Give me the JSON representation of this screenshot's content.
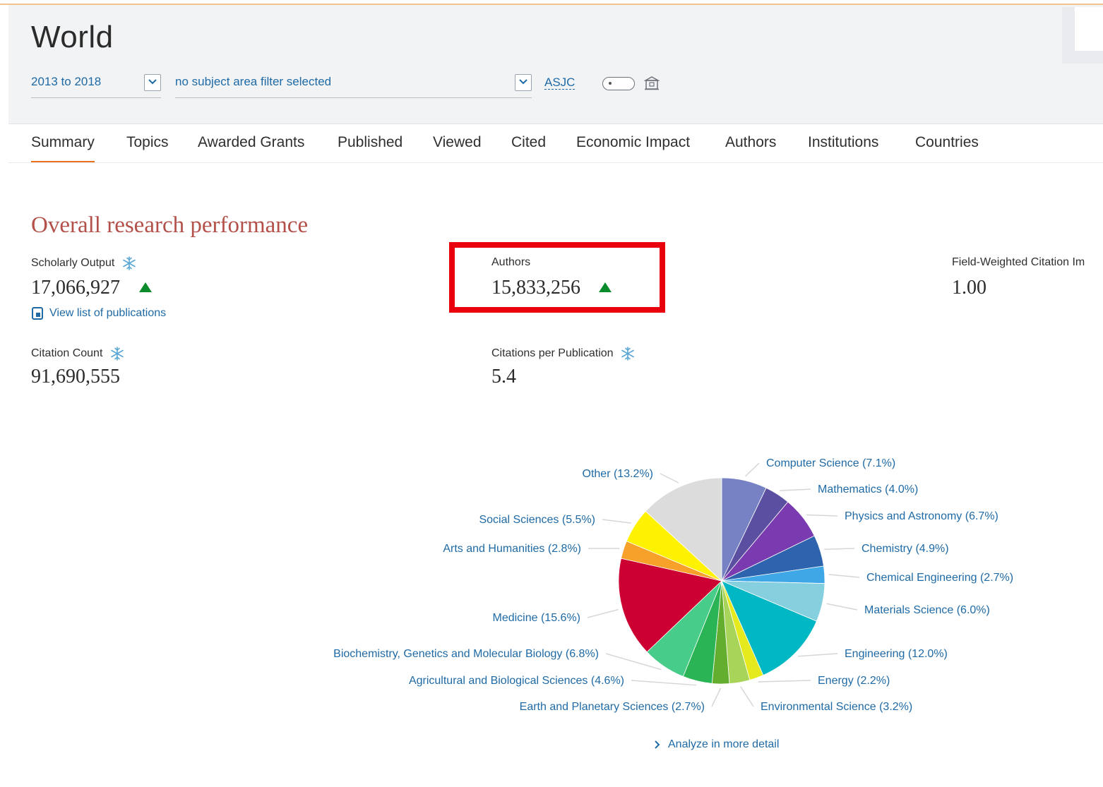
{
  "header": {
    "title": "World",
    "year_range": "2013 to 2018",
    "subject_filter": "no subject area filter selected",
    "asjc_label": "ASJC"
  },
  "tabs": [
    {
      "label": "Summary",
      "active": true
    },
    {
      "label": "Topics"
    },
    {
      "label": "Awarded Grants"
    },
    {
      "label": "Published"
    },
    {
      "label": "Viewed"
    },
    {
      "label": "Cited"
    },
    {
      "label": "Economic Impact"
    },
    {
      "label": "Authors"
    },
    {
      "label": "Institutions"
    },
    {
      "label": "Countries"
    }
  ],
  "overview": {
    "title": "Overall research performance",
    "scholarly_output_label": "Scholarly Output",
    "scholarly_output_value": "17,066,927",
    "view_list_label": "View list of publications",
    "authors_label": "Authors",
    "authors_value": "15,833,256",
    "fwci_label": "Field-Weighted Citation Im",
    "fwci_value": "1.00",
    "citation_count_label": "Citation Count",
    "citation_count_value": "91,690,555",
    "cpp_label": "Citations per Publication",
    "cpp_value": "5.4"
  },
  "analyze_label": "Analyze in more detail",
  "colors": {
    "accent_orange": "#e9711c",
    "section_title": "#b3504a",
    "link_blue": "#1f6aa5",
    "trend_up_green": "#0b8b2b",
    "highlight_red": "#e8000d"
  },
  "chart_data": {
    "type": "pie",
    "series": [
      {
        "label": "Computer Science (7.1%)",
        "value": 7.1,
        "color": "#7682c4"
      },
      {
        "label": "Mathematics (4.0%)",
        "value": 4.0,
        "color": "#5a4fa0"
      },
      {
        "label": "Physics and Astronomy (6.7%)",
        "value": 6.7,
        "color": "#7a3ab0"
      },
      {
        "label": "Chemistry (4.9%)",
        "value": 4.9,
        "color": "#2e63ad"
      },
      {
        "label": "Chemical Engineering (2.7%)",
        "value": 2.7,
        "color": "#40a7e6"
      },
      {
        "label": "Materials Science (6.0%)",
        "value": 6.0,
        "color": "#86cfdf"
      },
      {
        "label": "Engineering (12.0%)",
        "value": 12.0,
        "color": "#00b8c3"
      },
      {
        "label": "Energy (2.2%)",
        "value": 2.2,
        "color": "#e4ea1e"
      },
      {
        "label": "Environmental Science (3.2%)",
        "value": 3.2,
        "color": "#a9d45a"
      },
      {
        "label": "Earth and Planetary Sciences (2.7%)",
        "value": 2.7,
        "color": "#63ad2f"
      },
      {
        "label": "Agricultural and Biological Sciences (4.6%)",
        "value": 4.6,
        "color": "#2ab455"
      },
      {
        "label": "Biochemistry, Genetics and Molecular Biology (6.8%)",
        "value": 6.8,
        "color": "#47cc8a"
      },
      {
        "label": "Medicine (15.6%)",
        "value": 15.6,
        "color": "#cc0033"
      },
      {
        "label": "Arts and Humanities (2.8%)",
        "value": 2.8,
        "color": "#f7a12a"
      },
      {
        "label": "Social Sciences (5.5%)",
        "value": 5.5,
        "color": "#fff200"
      },
      {
        "label": "Other (13.2%)",
        "value": 13.2,
        "color": "#dcdcdc"
      }
    ]
  }
}
